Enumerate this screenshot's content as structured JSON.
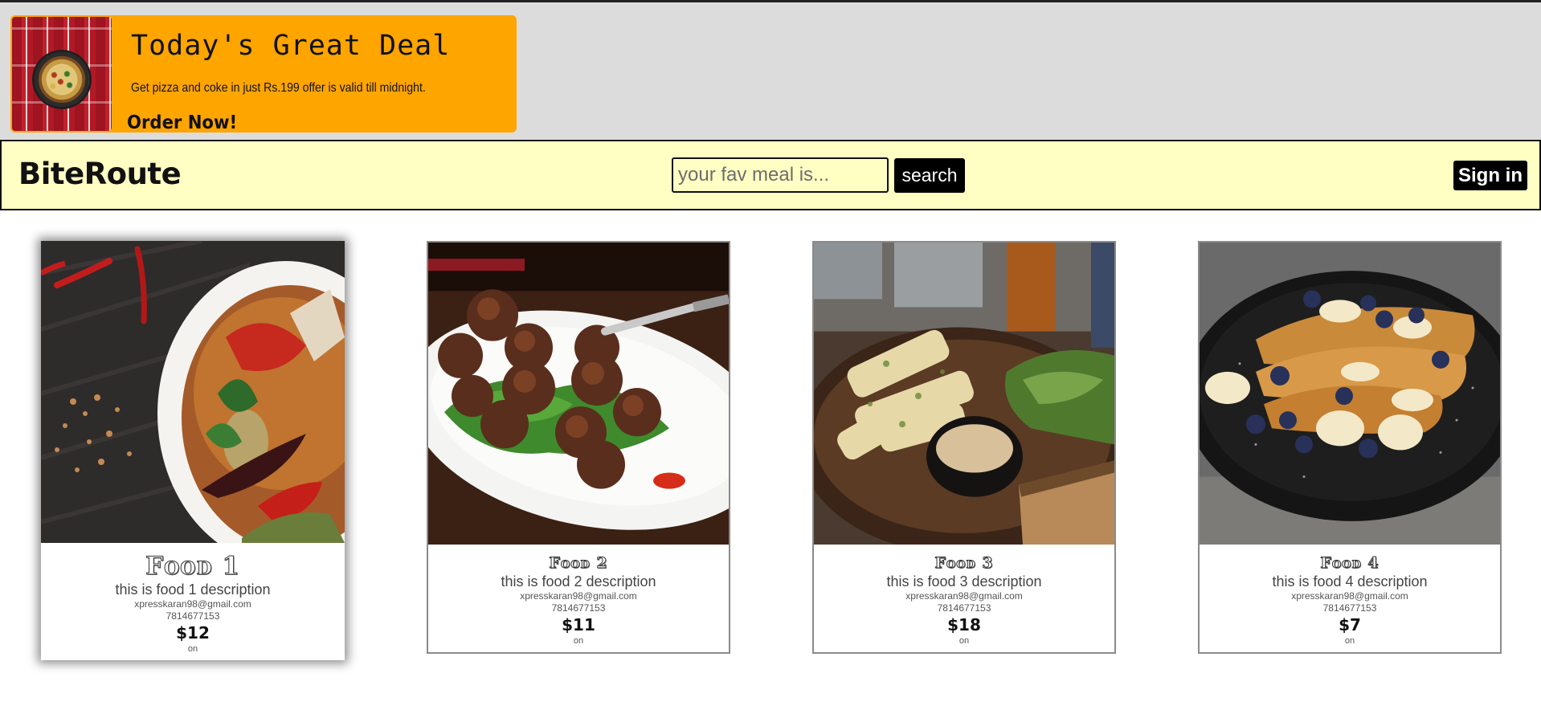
{
  "deal": {
    "title": "Today's Great Deal",
    "text": "Get pizza and coke in just Rs.199 offer is valid till midnight.",
    "cta": "Order Now!",
    "image_icon": "pizza-coke-image"
  },
  "navbar": {
    "brand": "BiteRoute",
    "search_placeholder": "your fav meal is...",
    "search_value": "",
    "search_button": "search",
    "signin_button": "Sign in"
  },
  "cards": [
    {
      "title": "Food 1",
      "description": "this is food 1 description",
      "email": "xpresskaran98@gmail.com",
      "phone": "7814677153",
      "price": "$12",
      "status": "on"
    },
    {
      "title": "Food 2",
      "description": "this is food 2 description",
      "email": "xpresskaran98@gmail.com",
      "phone": "7814677153",
      "price": "$11",
      "status": "on"
    },
    {
      "title": "Food 3",
      "description": "this is food 3 description",
      "email": "xpresskaran98@gmail.com",
      "phone": "7814677153",
      "price": "$18",
      "status": "on"
    },
    {
      "title": "Food 4",
      "description": "this is food 4 description",
      "email": "xpresskaran98@gmail.com",
      "phone": "7814677153",
      "price": "$7",
      "status": "on"
    }
  ],
  "colors": {
    "deal_background": "#ffa500",
    "navbar_background": "#ffffc4",
    "top_background": "#dcdcdc",
    "button_background": "#000000"
  }
}
